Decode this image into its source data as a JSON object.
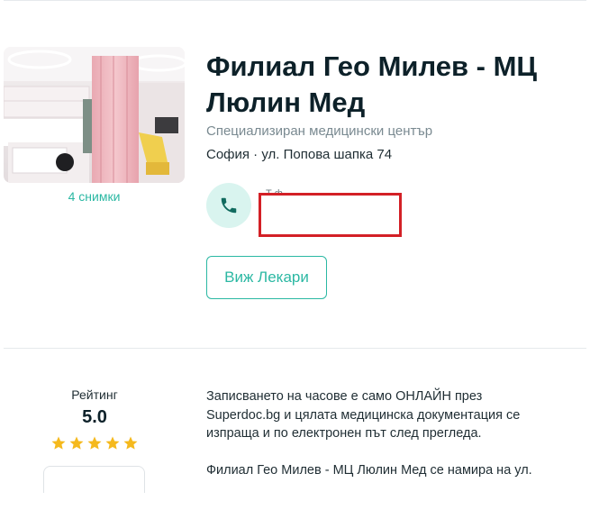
{
  "clinic": {
    "name": "Филиал Гео Милев - МЦ Люлин Мед",
    "type": "Специализиран медицински център",
    "address": "София · ул. Попова шапка 74",
    "photos_label": "4 снимки"
  },
  "phone": {
    "label_fragment": "Т    ф",
    "icon": "phone-icon"
  },
  "actions": {
    "view_doctors": "Виж Лекари"
  },
  "rating": {
    "label": "Рейтинг",
    "value": "5.0",
    "stars": 5,
    "star_color": "#f5b91d"
  },
  "description": {
    "paragraph1": "Записването на часове е само ОНЛАЙН през Superdoc.bg и цялата медицинска документация се изпраща и по електронен път след прегледа.",
    "paragraph2": "Филиал Гео Милев - МЦ Люлин Мед се намира на ул."
  },
  "colors": {
    "accent": "#2bb8a3",
    "accent_light": "#d9f4ef",
    "title": "#0d2129",
    "redaction": "#d32026"
  }
}
